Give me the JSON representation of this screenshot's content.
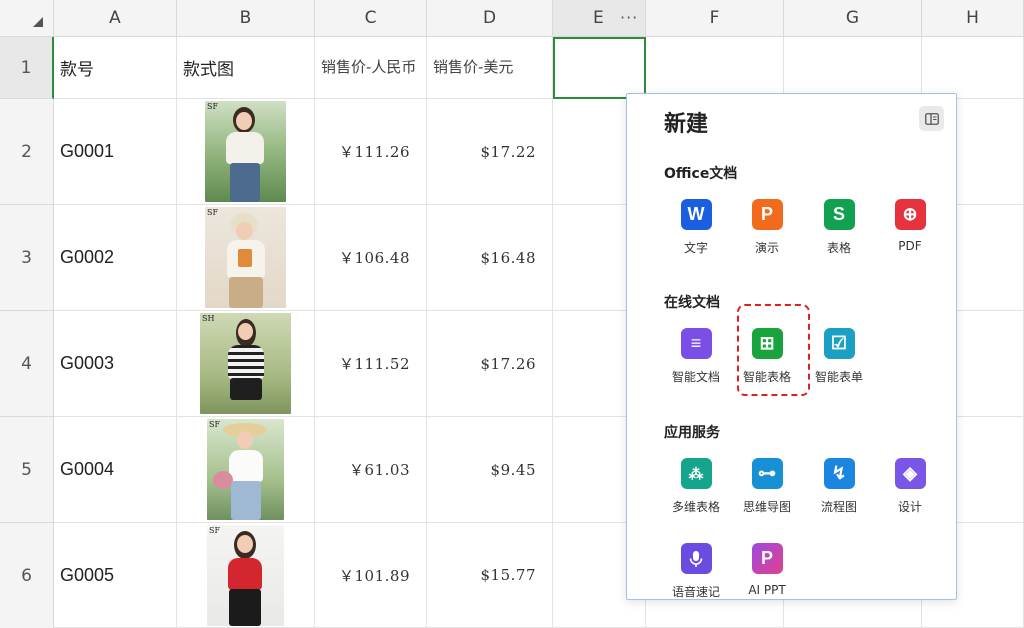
{
  "columns": [
    "A",
    "B",
    "C",
    "D",
    "E",
    "F",
    "G",
    "H"
  ],
  "selected_column_more": "···",
  "rows": [
    "1",
    "2",
    "3",
    "4",
    "5",
    "6"
  ],
  "header_row": {
    "a": "款号",
    "b": "款式图",
    "c": "销售价-人民币",
    "d": "销售价-美元"
  },
  "products": [
    {
      "id": "G0001",
      "cny": "￥111.26",
      "usd": "$17.22"
    },
    {
      "id": "G0002",
      "cny": "￥106.48",
      "usd": "$16.48"
    },
    {
      "id": "G0003",
      "cny": "￥111.52",
      "usd": "$17.26"
    },
    {
      "id": "G0004",
      "cny": "￥61.03",
      "usd": "$9.45"
    },
    {
      "id": "G0005",
      "cny": "￥101.89",
      "usd": "$15.77"
    }
  ],
  "product_image_marks": [
    "SF",
    "SF",
    "SH",
    "SF",
    "SF"
  ],
  "panel": {
    "title": "新建",
    "toggle_icon": "sidebar-panel-icon",
    "sections": {
      "office": "Office文档",
      "online": "在线文档",
      "services": "应用服务"
    },
    "office_apps": [
      {
        "label": "文字",
        "glyph": "W",
        "color": "#1a5fe0",
        "icon": "word-icon"
      },
      {
        "label": "演示",
        "glyph": "P",
        "color": "#f26b1d",
        "icon": "presentation-icon"
      },
      {
        "label": "表格",
        "glyph": "S",
        "color": "#12a150",
        "icon": "spreadsheet-icon"
      },
      {
        "label": "PDF",
        "glyph": "⊕",
        "color": "#e5323c",
        "icon": "pdf-icon"
      }
    ],
    "online_apps": [
      {
        "label": "智能文档",
        "glyph": "≡",
        "color": "#7b4fe6",
        "icon": "smart-doc-icon"
      },
      {
        "label": "智能表格",
        "glyph": "⊞",
        "color": "#18a33d",
        "icon": "smart-table-icon"
      },
      {
        "label": "智能表单",
        "glyph": "☑",
        "color": "#1aa0c4",
        "icon": "smart-form-icon"
      }
    ],
    "service_apps": [
      {
        "label": "多维表格",
        "glyph": "⁂",
        "color": "#14a58c",
        "icon": "multi-table-icon"
      },
      {
        "label": "思维导图",
        "glyph": "⊶",
        "color": "#1790d6",
        "icon": "mind-map-icon"
      },
      {
        "label": "流程图",
        "glyph": "↯",
        "color": "#1a86e0",
        "icon": "flowchart-icon"
      },
      {
        "label": "设计",
        "glyph": "◈",
        "color": "#7a56e8",
        "icon": "design-icon"
      },
      {
        "label": "语音速记",
        "glyph": "🎙",
        "color": "#6b4be0",
        "icon": "voice-note-icon"
      },
      {
        "label": "AI PPT",
        "glyph": "P",
        "color": "#cf3fb6",
        "icon": "ai-ppt-icon"
      }
    ]
  }
}
